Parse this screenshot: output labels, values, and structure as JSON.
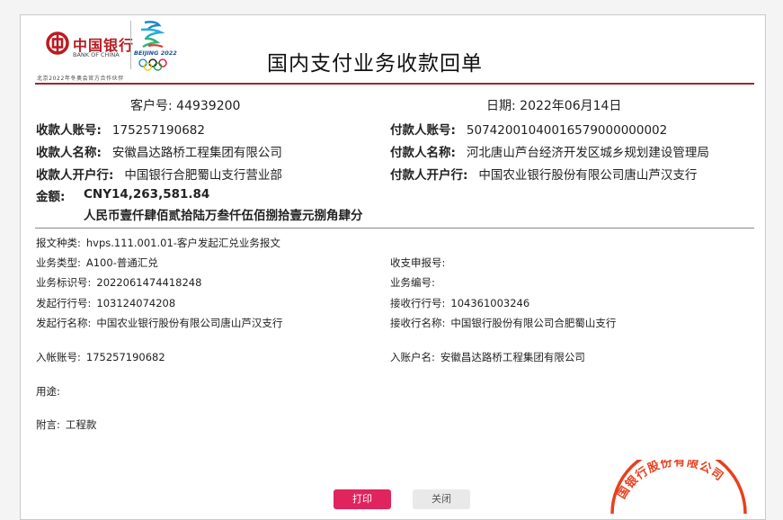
{
  "header": {
    "bank_name_cn": "中国银行",
    "bank_name_en": "BANK OF CHINA",
    "beijing_logo_text": "BEIJING 2022",
    "partner_text": "北京2022年冬奥会官方合作伙伴",
    "title": "国内支付业务收款回单",
    "brand_color": "#b81c22"
  },
  "meta": {
    "customer_no_label": "客户号:",
    "customer_no": "44939200",
    "date_label": "日期:",
    "date": "2022年06月14日"
  },
  "payee": {
    "account_label": "收款人账号:",
    "account": "175257190682",
    "name_label": "收款人名称:",
    "name": "安徽昌达路桥工程集团有限公司",
    "bank_label": "收款人开户行:",
    "bank": "中国银行合肥蜀山支行营业部"
  },
  "payer": {
    "account_label": "付款人账号:",
    "account": "50742001040016579000000002",
    "name_label": "付款人名称:",
    "name": "河北唐山芦台经济开发区城乡规划建设管理局",
    "bank_label": "付款人开户行:",
    "bank": "中国农业银行股份有限公司唐山芦汉支行"
  },
  "amount": {
    "label": "金额:",
    "numeric": "CNY14,263,581.84",
    "chinese": "人民币壹仟肆佰贰拾陆万叁仟伍佰捌拾壹元捌角肆分"
  },
  "details": {
    "msg_type_label": "报文种类:",
    "msg_type": "hvps.111.001.01-客户发起汇兑业务报文",
    "biz_type_label": "业务类型:",
    "biz_type": "A100-普通汇兑",
    "receipt_no_label": "收支申报号:",
    "receipt_no": "",
    "biz_id_label": "业务标识号:",
    "biz_id": "2022061474418248",
    "biz_no_label": "业务编号:",
    "biz_no": "",
    "origin_bank_no_label": "发起行行号:",
    "origin_bank_no": "103124074208",
    "recv_bank_no_label": "接收行行号:",
    "recv_bank_no": "104361003246",
    "origin_bank_name_label": "发起行名称:",
    "origin_bank_name": "中国农业银行股份有限公司唐山芦汉支行",
    "recv_bank_name_label": "接收行名称:",
    "recv_bank_name": "中国银行股份有限公司合肥蜀山支行",
    "in_account_label": "入帐账号:",
    "in_account": "175257190682",
    "in_account_name_label": "入账户名:",
    "in_account_name": "安徽昌达路桥工程集团有限公司",
    "purpose_label": "用途:",
    "purpose": "",
    "remark_label": "附言:",
    "remark": "工程款"
  },
  "seal": {
    "text": "国银行股份有限公司",
    "color": "#e8401e"
  },
  "buttons": {
    "print_label": "打印",
    "close_label": "关闭"
  }
}
